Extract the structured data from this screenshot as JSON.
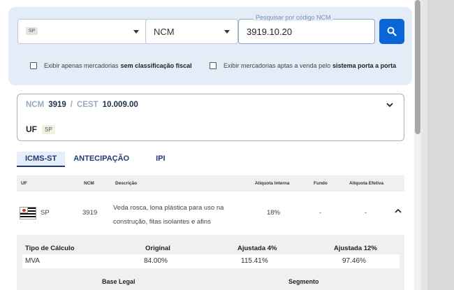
{
  "filters": {
    "uf_chip": "SP",
    "search_type": "NCM",
    "ncm_label": "Pesquisar por código NCM",
    "ncm_value": "3919.10.20",
    "check1_text": "Exibir apenas mercadorias",
    "check1_bold": "sem classificação fiscal",
    "check2_text": "Exibir mercadorias aptas a venda pelo",
    "check2_bold": "sistema porta a porta"
  },
  "ncm_card": {
    "ncm_label": "NCM",
    "ncm_value": "3919",
    "separator": "/",
    "cest_label": "CEST",
    "cest_value": "10.009.00",
    "uf_label": "UF",
    "uf_badge": "SP"
  },
  "tabs": [
    "ICMS-ST",
    "ANTECIPAÇÃO",
    "IPI"
  ],
  "table": {
    "headers": [
      "UF",
      "NCM",
      "Descrição",
      "Alíquota Interna",
      "Fundo",
      "Alíquota Efetiva"
    ],
    "row": {
      "uf": "SP",
      "ncm": "3919",
      "descricao": "Veda rosca, lona plástica para uso na construção, fitas isolantes e afins",
      "aliquota_interna": "18%",
      "fundo": "-",
      "aliquota_efetiva": "-"
    }
  },
  "detail": {
    "headers": [
      "Tipo de Cálculo",
      "Original",
      "Ajustada 4%",
      "Ajustada 12%"
    ],
    "row": [
      "MVA",
      "84.00%",
      "115.41%",
      "97.46%"
    ],
    "legal_headers": [
      "Base Legal",
      "Segmento"
    ]
  },
  "colors": {
    "primary": "#0a66d6",
    "panel_bg": "#e3ecf7",
    "navy": "#1f2e4a"
  }
}
